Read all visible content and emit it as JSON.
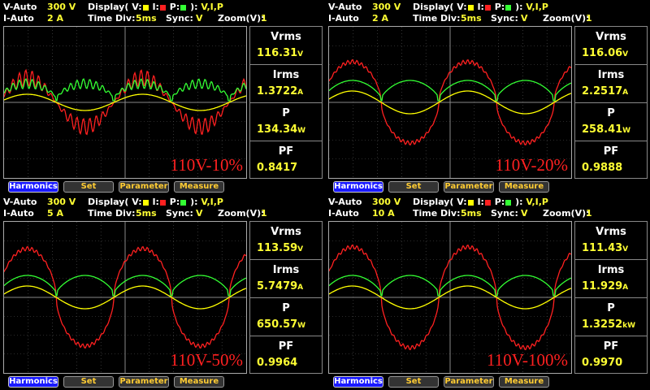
{
  "panels": [
    {
      "v_mode": "V-Auto",
      "v_range": "300 V",
      "i_mode": "I-Auto",
      "i_range": "2 A",
      "display_label": "Display( V:",
      "display_i": " I:",
      "display_p": " P:",
      "display_close": " ):",
      "display_value": "V,I,P",
      "time_div_label": "Time Div:",
      "time_div": "5ms",
      "sync_label": "Sync:",
      "sync": "V",
      "zoom_label": "Zoom(V):",
      "zoom": "1",
      "vrms_label": "Vrms",
      "vrms": "116.31",
      "vrms_unit": "V",
      "irms_label": "Irms",
      "irms": "1.3722",
      "irms_unit": "A",
      "p_label": "P",
      "p": "134.34",
      "p_unit": "W",
      "pf_label": "PF",
      "pf": "0.8417",
      "tag": "110V-10%"
    },
    {
      "v_mode": "V-Auto",
      "v_range": "300 V",
      "i_mode": "I-Auto",
      "i_range": "2 A",
      "display_label": "Display( V:",
      "display_i": " I:",
      "display_p": " P:",
      "display_close": " ):",
      "display_value": "V,I,P",
      "time_div_label": "Time Div:",
      "time_div": "5ms",
      "sync_label": "Sync:",
      "sync": "V",
      "zoom_label": "Zoom(V):",
      "zoom": "1",
      "vrms_label": "Vrms",
      "vrms": "116.06",
      "vrms_unit": "V",
      "irms_label": "Irms",
      "irms": "2.2517",
      "irms_unit": "A",
      "p_label": "P",
      "p": "258.41",
      "p_unit": "W",
      "pf_label": "PF",
      "pf": "0.9888",
      "tag": "110V-20%"
    },
    {
      "v_mode": "V-Auto",
      "v_range": "300 V",
      "i_mode": "I-Auto",
      "i_range": "5 A",
      "display_label": "Display( V:",
      "display_i": " I:",
      "display_p": " P:",
      "display_close": " ):",
      "display_value": "V,I,P",
      "time_div_label": "Time Div:",
      "time_div": "5ms",
      "sync_label": "Sync:",
      "sync": "V",
      "zoom_label": "Zoom(V):",
      "zoom": "1",
      "vrms_label": "Vrms",
      "vrms": "113.59",
      "vrms_unit": "V",
      "irms_label": "Irms",
      "irms": "5.7479",
      "irms_unit": "A",
      "p_label": "P",
      "p": "650.57",
      "p_unit": "W",
      "pf_label": "PF",
      "pf": "0.9964",
      "tag": "110V-50%"
    },
    {
      "v_mode": "V-Auto",
      "v_range": "300 V",
      "i_mode": "I-Auto",
      "i_range": "10 A",
      "display_label": "Display( V:",
      "display_i": " I:",
      "display_p": " P:",
      "display_close": " ):",
      "display_value": "V,I,P",
      "time_div_label": "Time Div:",
      "time_div": "5ms",
      "sync_label": "Sync:",
      "sync": "V",
      "zoom_label": "Zoom(V):",
      "zoom": "1",
      "vrms_label": "Vrms",
      "vrms": "111.43",
      "vrms_unit": "V",
      "irms_label": "Irms",
      "irms": "11.929",
      "irms_unit": "A",
      "p_label": "P",
      "p": "1.3252",
      "p_unit": "kW",
      "pf_label": "PF",
      "pf": "0.9970",
      "tag": "110V-100%"
    }
  ],
  "buttons": {
    "harmonics": "Harmonics",
    "set": "Set",
    "parameter": "Parameter",
    "measure": "Measure"
  },
  "colors": {
    "voltage": "#ffff00",
    "current": "#ff2020",
    "power": "#33ff33",
    "grid": "#555555",
    "active_button": "#1a1aff"
  }
}
